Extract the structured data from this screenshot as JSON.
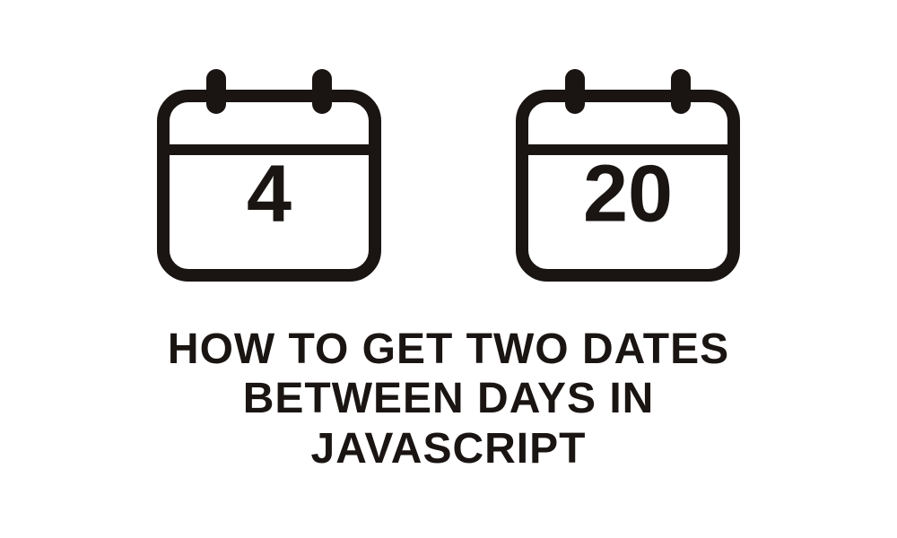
{
  "calendars": [
    {
      "day": "4"
    },
    {
      "day": "20"
    }
  ],
  "title_line1": "HOW TO GET TWO DATES",
  "title_line2": "BETWEEN DAYS IN",
  "title_line3": "JAVASCRIPT",
  "colors": {
    "icon_stroke": "#1a1513",
    "text": "#1a1513",
    "background": "#ffffff"
  }
}
